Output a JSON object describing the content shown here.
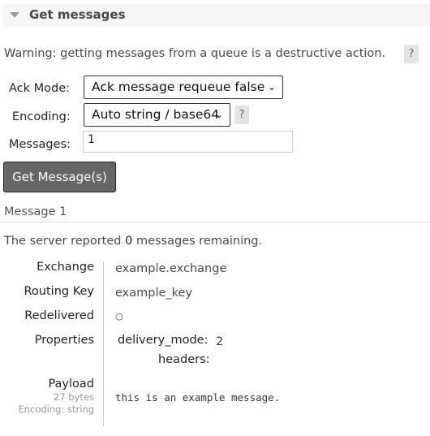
{
  "section": {
    "title": "Get messages",
    "collapse_icon": "triangle-down-icon"
  },
  "warning": {
    "text": "Warning: getting messages from a queue is a destructive action.",
    "help": "?"
  },
  "form": {
    "ack_mode": {
      "label": "Ack Mode:",
      "value": "Ack message requeue false"
    },
    "encoding": {
      "label": "Encoding:",
      "value": "Auto string / base64",
      "help": "?"
    },
    "messages": {
      "label": "Messages:",
      "value": "1"
    },
    "submit": "Get Message(s)"
  },
  "result": {
    "heading": "Message 1",
    "remaining_prefix": "The server reported ",
    "remaining_count": "0",
    "remaining_suffix": " messages remaining.",
    "exchange": {
      "label": "Exchange",
      "value": "example.exchange"
    },
    "routing_key": {
      "label": "Routing Key",
      "value": "example_key"
    },
    "redelivered": {
      "label": "Redelivered",
      "value": "○"
    },
    "properties": {
      "label": "Properties",
      "delivery_mode_key": "delivery_mode:",
      "delivery_mode_value": "2",
      "headers_key": "headers:"
    },
    "payload": {
      "label": "Payload",
      "size": "27 bytes",
      "encoding": "Encoding: string",
      "value": "this is an example message."
    }
  }
}
